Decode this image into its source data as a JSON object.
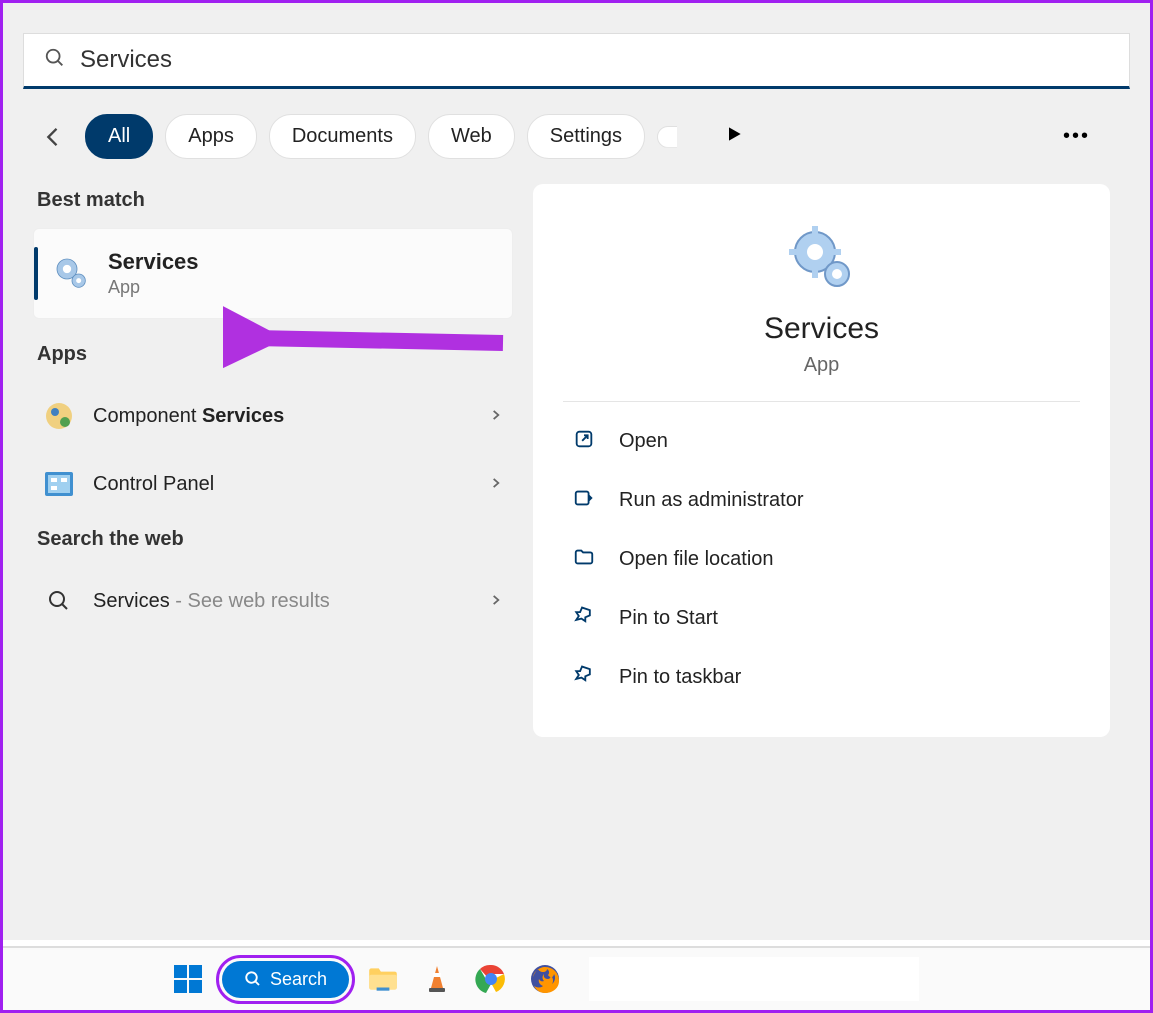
{
  "search": {
    "value": "Services"
  },
  "filters": {
    "items": [
      "All",
      "Apps",
      "Documents",
      "Web",
      "Settings"
    ]
  },
  "sections": {
    "best_match": "Best match",
    "apps": "Apps",
    "search_web": "Search the web"
  },
  "best_match": {
    "title": "Services",
    "subtitle": "App"
  },
  "apps_list": [
    {
      "label_prefix": "Component ",
      "label_bold": "Services"
    },
    {
      "label_prefix": "Control Panel",
      "label_bold": ""
    }
  ],
  "web_result": {
    "term": "Services",
    "suffix": " - See web results"
  },
  "preview": {
    "title": "Services",
    "subtitle": "App",
    "actions": [
      "Open",
      "Run as administrator",
      "Open file location",
      "Pin to Start",
      "Pin to taskbar"
    ]
  },
  "taskbar": {
    "search_label": "Search"
  }
}
